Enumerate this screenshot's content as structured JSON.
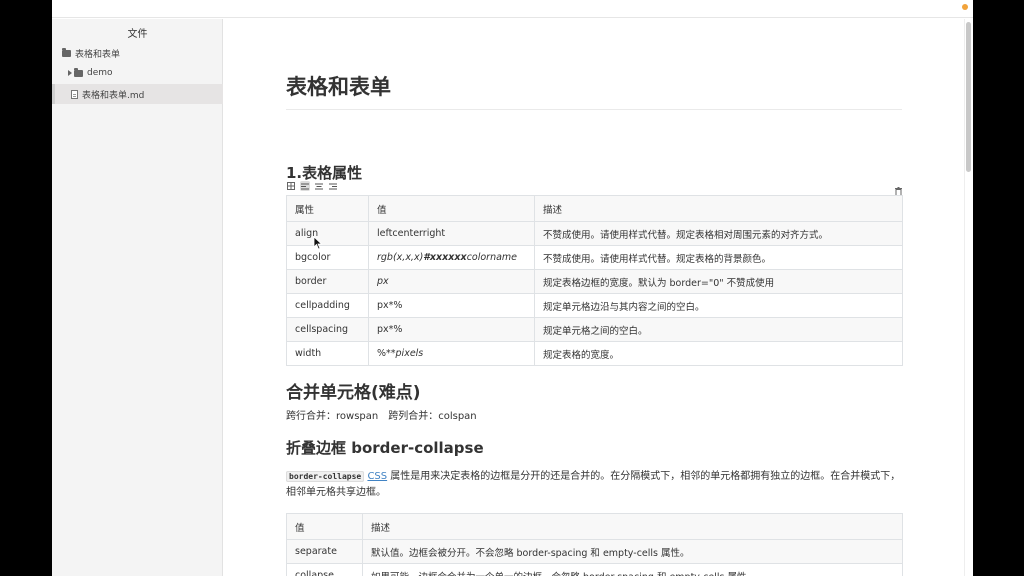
{
  "sidebar": {
    "title": "文件",
    "items": [
      {
        "label": "表格和表单",
        "type": "folder"
      },
      {
        "label": "demo",
        "type": "folder"
      },
      {
        "label": "表格和表单.md",
        "type": "file"
      }
    ]
  },
  "doc": {
    "title": "表格和表单",
    "section1": "1.表格属性",
    "table1": {
      "headers": [
        "属性",
        "值",
        "描述"
      ],
      "rows": [
        {
          "attr": "align",
          "value": "leftcenterright",
          "desc": "不赞成使用。请使用样式代替。规定表格相对周围元素的对齐方式。"
        },
        {
          "attr": "bgcolor",
          "value_a": "rgb(x,x,x)",
          "value_b": "#xxxxxx",
          "value_c": "colorname",
          "desc": "不赞成使用。请使用样式代替。规定表格的背景颜色。"
        },
        {
          "attr": "border",
          "value": "px",
          "desc": "规定表格边框的宽度。默认为 border=\"0\" 不赞成使用"
        },
        {
          "attr": "cellpadding",
          "value": "px*%",
          "desc": "规定单元格边沿与其内容之间的空白。"
        },
        {
          "attr": "cellspacing",
          "value": "px*%",
          "desc": "规定单元格之间的空白。"
        },
        {
          "attr": "width",
          "value_a": "%**",
          "value_b": "pixels",
          "desc": "规定表格的宽度。"
        }
      ]
    },
    "section2": "合并单元格(难点)",
    "merge_text": "跨行合并：rowspan　跨列合并：colspan",
    "section3": "折叠边框 border-collapse",
    "collapse_code": "border-collapse",
    "collapse_link": "CSS",
    "collapse_text": " 属性是用来决定表格的边框是分开的还是合并的。在分隔模式下，相邻的单元格都拥有独立的边框。在合并模式下，相邻单元格共享边框。",
    "table2": {
      "headers": [
        "值",
        "描述"
      ],
      "rows": [
        {
          "value": "separate",
          "desc": "默认值。边框会被分开。不会忽略 border-spacing 和 empty-cells 属性。"
        },
        {
          "value": "collapse",
          "desc": "如果可能，边框会合并为一个单一的边框。会忽略 border-spacing 和 empty-cells 属性。"
        }
      ]
    }
  },
  "colors": {
    "accent_dot": "#f2a33a",
    "link": "#4183c4"
  }
}
